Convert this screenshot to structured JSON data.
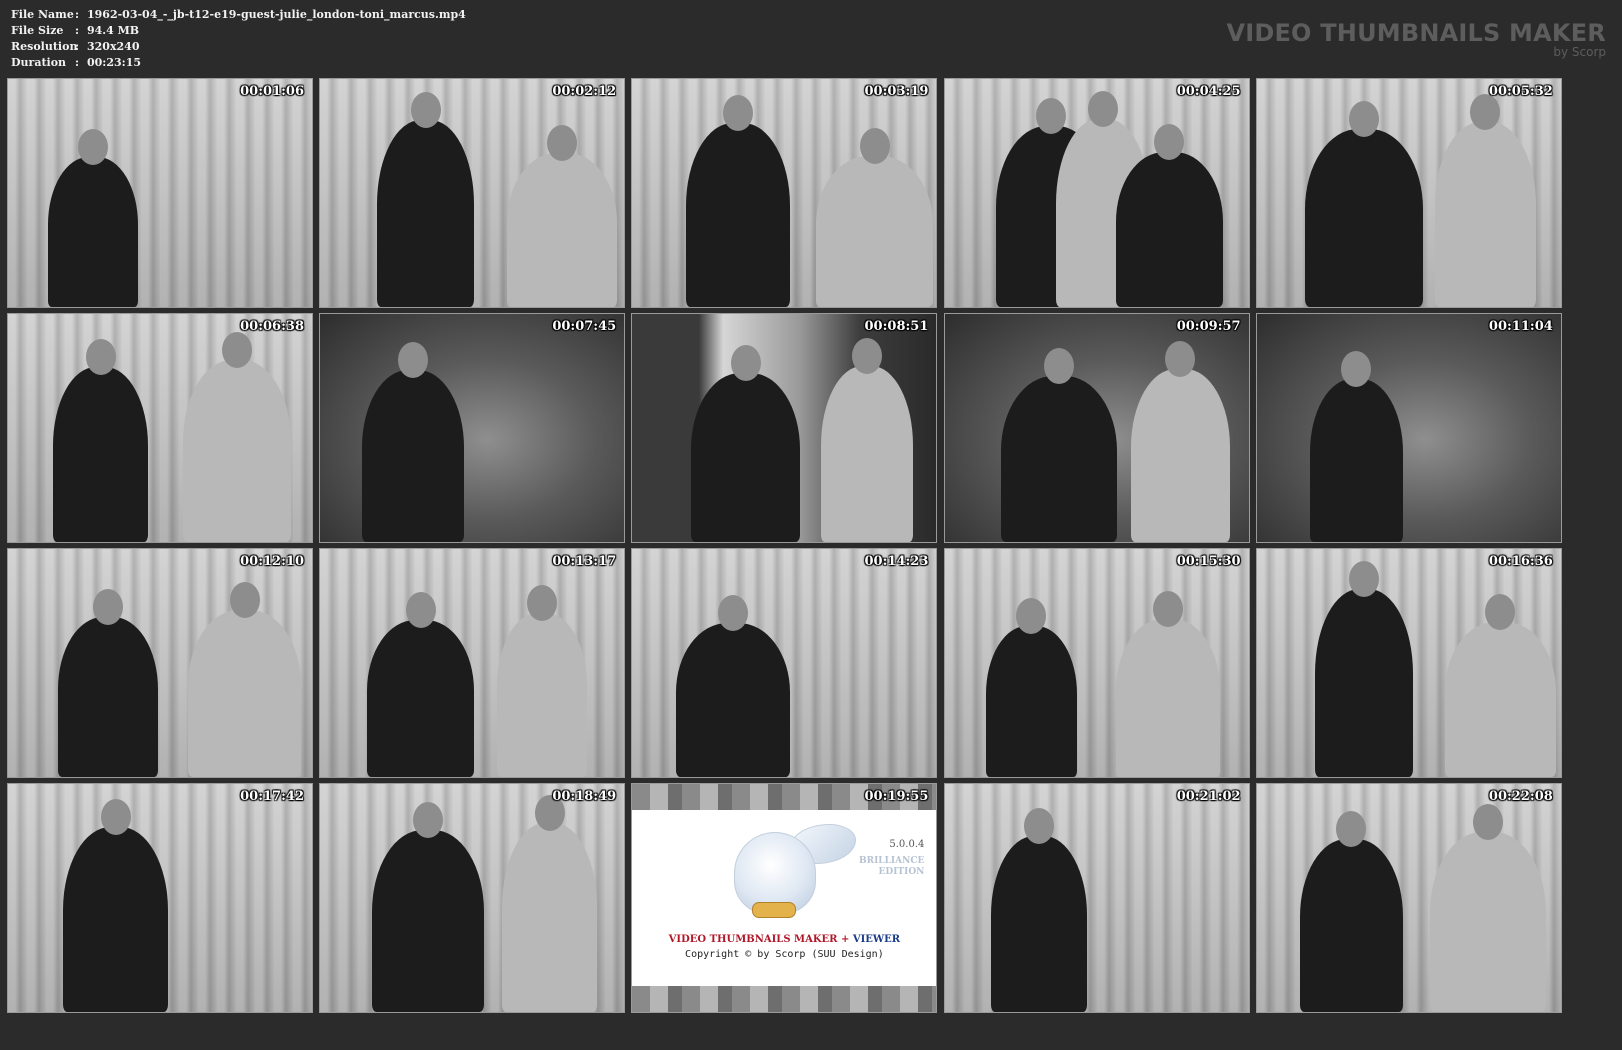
{
  "file_info": {
    "rows": [
      {
        "label": "File Name",
        "sep": ":",
        "value": "1962-03-04_-_jb-t12-e19-guest-julie_london-toni_marcus.mp4"
      },
      {
        "label": "File Size",
        "sep": ":",
        "value": "94.4 MB"
      },
      {
        "label": "Resolution",
        "sep": ":",
        "value": "320x240"
      },
      {
        "label": "Duration",
        "sep": ":",
        "value": "00:23:15"
      }
    ]
  },
  "branding": {
    "title": "VIDEO THUMBNAILS MAKER",
    "subtitle": "by Scorp"
  },
  "thumbnails": [
    {
      "timestamp": "00:01:06",
      "scene": "curtain"
    },
    {
      "timestamp": "00:02:12",
      "scene": "curtain"
    },
    {
      "timestamp": "00:03:19",
      "scene": "curtain"
    },
    {
      "timestamp": "00:04:25",
      "scene": "curtain"
    },
    {
      "timestamp": "00:05:32",
      "scene": "curtain"
    },
    {
      "timestamp": "00:06:38",
      "scene": "curtain"
    },
    {
      "timestamp": "00:07:45",
      "scene": "dark"
    },
    {
      "timestamp": "00:08:51",
      "scene": "room"
    },
    {
      "timestamp": "00:09:57",
      "scene": "dark"
    },
    {
      "timestamp": "00:11:04",
      "scene": "dark"
    },
    {
      "timestamp": "00:12:10",
      "scene": "curtain"
    },
    {
      "timestamp": "00:13:17",
      "scene": "curtain"
    },
    {
      "timestamp": "00:14:23",
      "scene": "curtain"
    },
    {
      "timestamp": "00:15:30",
      "scene": "curtain"
    },
    {
      "timestamp": "00:16:36",
      "scene": "curtain"
    },
    {
      "timestamp": "00:17:42",
      "scene": "curtain"
    },
    {
      "timestamp": "00:18:49",
      "scene": "curtain"
    },
    {
      "timestamp": "00:19:55",
      "scene": "logo"
    },
    {
      "timestamp": "00:21:02",
      "scene": "curtain"
    },
    {
      "timestamp": "00:22:08",
      "scene": "curtain"
    }
  ],
  "logo_card": {
    "version": "5.0.0.4",
    "edition_line1": "BRILLIANCE",
    "edition_line2": "EDITION",
    "product_part1": "VIDEO THUMBNAILS MAKER",
    "product_plus": "+",
    "product_part2": "VIEWER",
    "copyright": "Copyright © by Scorp (SUU Design)"
  }
}
